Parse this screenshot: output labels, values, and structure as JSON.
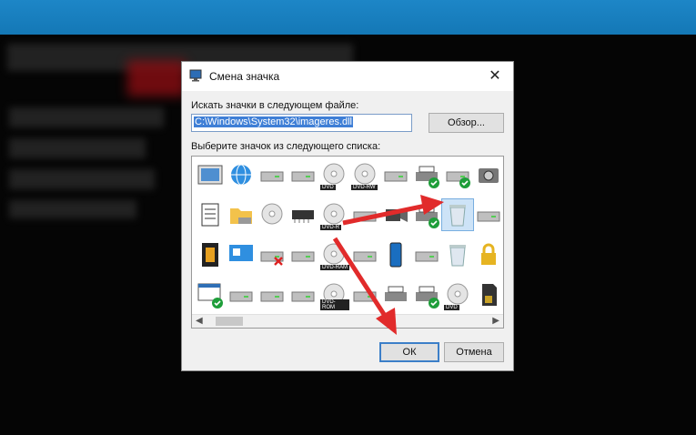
{
  "dialog": {
    "title": "Смена значка",
    "close_glyph": "✕",
    "file_label": "Искать значки в следующем файле:",
    "file_path": "C:\\Windows\\System32\\imageres.dll",
    "browse_label": "Обзор...",
    "list_label": "Выберите значок из следующего списка:",
    "ok_label": "ОК",
    "cancel_label": "Отмена"
  },
  "icon_list": {
    "rows": [
      [
        {
          "name": "picture-frame-icon"
        },
        {
          "name": "network-globe-icon"
        },
        {
          "name": "floppy-drive-icon"
        },
        {
          "name": "drive-green-icon"
        },
        {
          "name": "dvd-drive-icon",
          "text": "DVD"
        },
        {
          "name": "dvd-rw-drive-icon",
          "text": "DVD-RW"
        },
        {
          "name": "network-drive-icon"
        },
        {
          "name": "printer-check-icon"
        },
        {
          "name": "drive-check-icon"
        },
        {
          "name": "camera-icon"
        }
      ],
      [
        {
          "name": "document-list-icon"
        },
        {
          "name": "folder-drive-icon"
        },
        {
          "name": "disc-drive-icon"
        },
        {
          "name": "memory-chip-icon"
        },
        {
          "name": "dvd-r-drive-icon",
          "text": "DVD-R"
        },
        {
          "name": "floppy-red-icon"
        },
        {
          "name": "camcorder-icon"
        },
        {
          "name": "printer-check-icon"
        },
        {
          "name": "recycle-bin-full-icon",
          "selected": true
        },
        {
          "name": "drive-icon"
        }
      ],
      [
        {
          "name": "film-icon"
        },
        {
          "name": "presentation-icon"
        },
        {
          "name": "drive-error-icon"
        },
        {
          "name": "drive-icon"
        },
        {
          "name": "dvd-ram-drive-icon",
          "text": "DVD-RAM"
        },
        {
          "name": "drive-usb-icon"
        },
        {
          "name": "phone-icon"
        },
        {
          "name": "drive-green-icon"
        },
        {
          "name": "recycle-bin-empty-icon"
        },
        {
          "name": "lock-icon"
        }
      ],
      [
        {
          "name": "window-check-icon"
        },
        {
          "name": "floppy-drive-icon"
        },
        {
          "name": "drive-icon"
        },
        {
          "name": "windows-drive-icon"
        },
        {
          "name": "dvd-rom-drive-icon",
          "text": "DVD-ROM"
        },
        {
          "name": "drive-icon"
        },
        {
          "name": "printer-icon"
        },
        {
          "name": "printer-check-icon"
        },
        {
          "name": "dvd-disc-icon",
          "text": "DVD"
        },
        {
          "name": "sd-card-icon"
        }
      ]
    ]
  },
  "scrollbar": {
    "left_arrow": "◀",
    "right_arrow": "▶"
  },
  "colors": {
    "accent": "#3c7fc8",
    "selection": "#3f7fd6",
    "annotation_arrow": "#e12b2b",
    "check": "#1e9e3a"
  }
}
